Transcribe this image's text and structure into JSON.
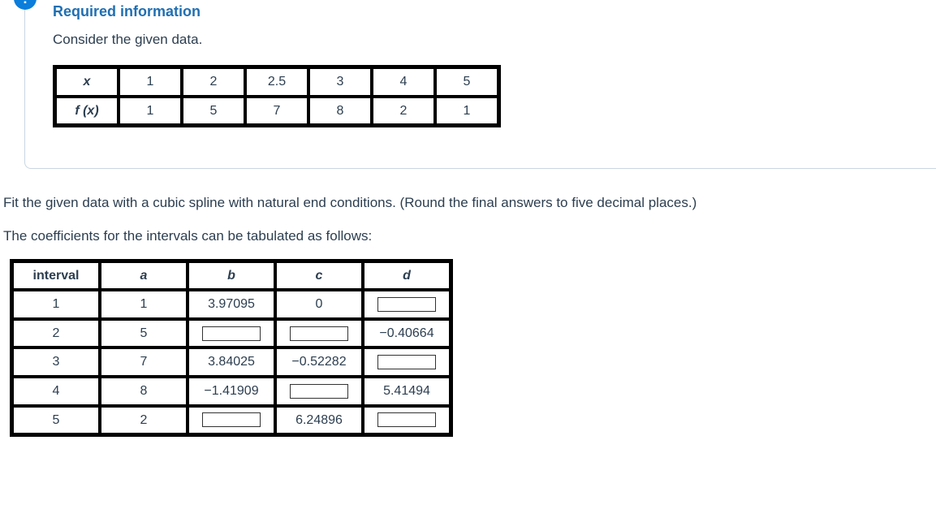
{
  "info": {
    "badge": "!",
    "heading": "Required information",
    "prompt": "Consider the given data.",
    "table": {
      "rowlabels": [
        "x",
        "f (x)"
      ],
      "xrow": [
        "1",
        "2",
        "2.5",
        "3",
        "4",
        "5"
      ],
      "frow": [
        "1",
        "5",
        "7",
        "8",
        "2",
        "1"
      ]
    }
  },
  "question": {
    "line1": "Fit the given data with a cubic spline with natural end conditions. (Round the final answers to five decimal places.)",
    "line2": "The coefficients for the intervals can be tabulated as follows:"
  },
  "coef": {
    "headers": [
      "interval",
      "a",
      "b",
      "c",
      "d"
    ],
    "rows": [
      {
        "interval": "1",
        "a": "1",
        "b": "3.97095",
        "c": "0",
        "d": null
      },
      {
        "interval": "2",
        "a": "5",
        "b": null,
        "c": null,
        "d": "−0.40664"
      },
      {
        "interval": "3",
        "a": "7",
        "b": "3.84025",
        "c": "−0.52282",
        "d": null
      },
      {
        "interval": "4",
        "a": "8",
        "b": "−1.41909",
        "c": null,
        "d": "5.41494"
      },
      {
        "interval": "5",
        "a": "2",
        "b": null,
        "c": "6.24896",
        "d": null
      }
    ]
  }
}
